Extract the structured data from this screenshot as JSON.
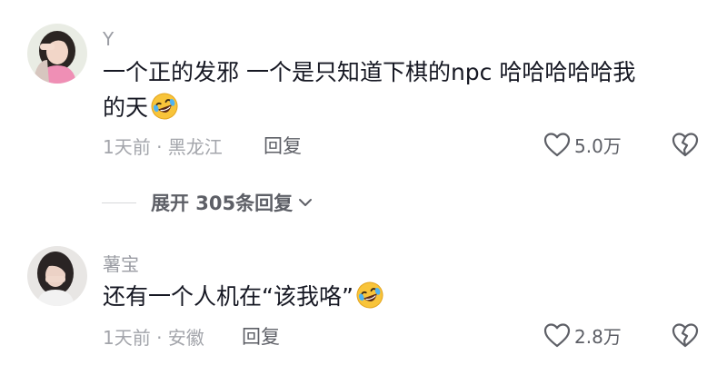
{
  "comments": [
    {
      "username": "Y",
      "text": "一个正的发邪  一个是只知道下棋的npc  哈哈哈哈哈我",
      "text_line2": "的天",
      "emoji": "rofl-emoji",
      "time_location": "1天前 · 黑龙江",
      "reply_label": "回复",
      "likes": "5.0万"
    },
    {
      "username": "薯宝",
      "text": "还有一个人机在“该我咯”",
      "emoji": "rofl-emoji",
      "time_location": "1天前 · 安徽",
      "reply_label": "回复",
      "likes": "2.8万"
    }
  ],
  "expand_replies": {
    "label": "展开 305条回复"
  },
  "colors": {
    "primary_text": "#161823",
    "secondary_text": "#a3a5ab",
    "action_text": "#5d5f66"
  }
}
